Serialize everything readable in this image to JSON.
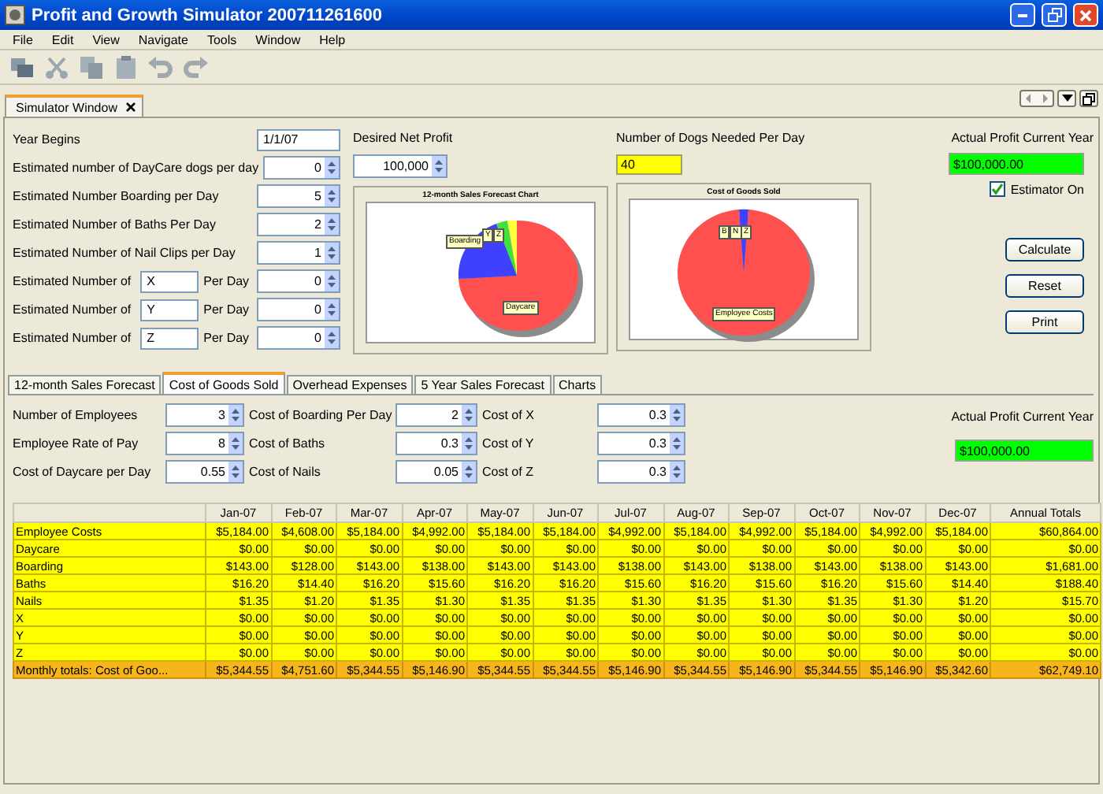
{
  "window": {
    "title": "Profit and Growth Simulator 200711261600"
  },
  "menu": [
    "File",
    "Edit",
    "View",
    "Navigate",
    "Tools",
    "Window",
    "Help"
  ],
  "document_tab": {
    "label": "Simulator Window",
    "selected": true
  },
  "year_begins": {
    "label": "Year Begins",
    "value": "1/1/07"
  },
  "estimates": [
    {
      "kind": "plain",
      "label": "Estimated number of DayCare dogs per day",
      "value": "0"
    },
    {
      "kind": "plain",
      "label": "Estimated Number Boarding per Day",
      "value": "5"
    },
    {
      "kind": "plain",
      "label": "Estimated Number of Baths Per Day",
      "value": "2"
    },
    {
      "kind": "plain",
      "label": "Estimated Number of Nail Clips per Day",
      "value": "1"
    },
    {
      "kind": "named",
      "label": "Estimated Number of",
      "name": "X",
      "suffix": "Per Day",
      "value": "0"
    },
    {
      "kind": "named",
      "label": "Estimated Number of",
      "name": "Y",
      "suffix": "Per Day",
      "value": "0"
    },
    {
      "kind": "named",
      "label": "Estimated Number of",
      "name": "Z",
      "suffix": "Per Day",
      "value": "0"
    }
  ],
  "desired_net_profit": {
    "label": "Desired Net Profit",
    "value": "100,000"
  },
  "dogs_needed": {
    "label": "Number of Dogs Needed Per Day",
    "value": "40"
  },
  "actual_profit": {
    "label": "Actual Profit Current Year",
    "value": "$100,000.00"
  },
  "estimator": {
    "label": "Estimator On",
    "checked": true
  },
  "charts": [
    {
      "title": "12-month Sales Forecast Chart",
      "labels": [
        "Boarding",
        "Y",
        "Z",
        "Daycare"
      ]
    },
    {
      "title": "Cost of Goods Sold",
      "labels": [
        "B",
        "N",
        "Z",
        "Employee Costs"
      ]
    }
  ],
  "buttons": [
    "Calculate",
    "Reset",
    "Print"
  ],
  "tabs": [
    {
      "label": "12-month Sales Forecast",
      "selected": false
    },
    {
      "label": "Cost of Goods Sold",
      "selected": true
    },
    {
      "label": "Overhead Expenses",
      "selected": false
    },
    {
      "label": "5 Year Sales Forecast",
      "selected": false
    },
    {
      "label": "Charts",
      "selected": false
    }
  ],
  "cost_fields": [
    {
      "label": "Number of Employees",
      "value": "3"
    },
    {
      "label": "Cost of Boarding Per Day",
      "value": "2"
    },
    {
      "label": "Cost of X",
      "value": "0.3"
    },
    {
      "label": "Employee Rate of Pay",
      "value": "8"
    },
    {
      "label": "Cost of Baths",
      "value": "0.3"
    },
    {
      "label": "Cost of Y",
      "value": "0.3"
    },
    {
      "label": "Cost of Daycare per Day",
      "value": "0.55"
    },
    {
      "label": "Cost of Nails",
      "value": "0.05"
    },
    {
      "label": "Cost of Z",
      "value": "0.3"
    }
  ],
  "cost_actual_profit": {
    "label": "Actual Profit Current Year",
    "value": "$100,000.00"
  },
  "table": {
    "columns": [
      "Jan-07",
      "Feb-07",
      "Mar-07",
      "Apr-07",
      "May-07",
      "Jun-07",
      "Jul-07",
      "Aug-07",
      "Sep-07",
      "Oct-07",
      "Nov-07",
      "Dec-07",
      "Annual Totals"
    ],
    "rows": [
      {
        "kind": "item",
        "label": "Employee Costs",
        "cells": [
          "$5,184.00",
          "$4,608.00",
          "$5,184.00",
          "$4,992.00",
          "$5,184.00",
          "$5,184.00",
          "$4,992.00",
          "$5,184.00",
          "$4,992.00",
          "$5,184.00",
          "$4,992.00",
          "$5,184.00",
          "$60,864.00"
        ]
      },
      {
        "kind": "item",
        "label": "Daycare",
        "cells": [
          "$0.00",
          "$0.00",
          "$0.00",
          "$0.00",
          "$0.00",
          "$0.00",
          "$0.00",
          "$0.00",
          "$0.00",
          "$0.00",
          "$0.00",
          "$0.00",
          "$0.00"
        ]
      },
      {
        "kind": "item",
        "label": "Boarding",
        "cells": [
          "$143.00",
          "$128.00",
          "$143.00",
          "$138.00",
          "$143.00",
          "$143.00",
          "$138.00",
          "$143.00",
          "$138.00",
          "$143.00",
          "$138.00",
          "$143.00",
          "$1,681.00"
        ]
      },
      {
        "kind": "item",
        "label": "Baths",
        "cells": [
          "$16.20",
          "$14.40",
          "$16.20",
          "$15.60",
          "$16.20",
          "$16.20",
          "$15.60",
          "$16.20",
          "$15.60",
          "$16.20",
          "$15.60",
          "$14.40",
          "$188.40"
        ]
      },
      {
        "kind": "item",
        "label": "Nails",
        "cells": [
          "$1.35",
          "$1.20",
          "$1.35",
          "$1.30",
          "$1.35",
          "$1.35",
          "$1.30",
          "$1.35",
          "$1.30",
          "$1.35",
          "$1.30",
          "$1.20",
          "$15.70"
        ]
      },
      {
        "kind": "item",
        "label": "X",
        "cells": [
          "$0.00",
          "$0.00",
          "$0.00",
          "$0.00",
          "$0.00",
          "$0.00",
          "$0.00",
          "$0.00",
          "$0.00",
          "$0.00",
          "$0.00",
          "$0.00",
          "$0.00"
        ]
      },
      {
        "kind": "item",
        "label": "Y",
        "cells": [
          "$0.00",
          "$0.00",
          "$0.00",
          "$0.00",
          "$0.00",
          "$0.00",
          "$0.00",
          "$0.00",
          "$0.00",
          "$0.00",
          "$0.00",
          "$0.00",
          "$0.00"
        ]
      },
      {
        "kind": "item",
        "label": "Z",
        "cells": [
          "$0.00",
          "$0.00",
          "$0.00",
          "$0.00",
          "$0.00",
          "$0.00",
          "$0.00",
          "$0.00",
          "$0.00",
          "$0.00",
          "$0.00",
          "$0.00",
          "$0.00"
        ]
      },
      {
        "kind": "total",
        "label": "Monthly totals: Cost of Goo...",
        "cells": [
          "$5,344.55",
          "$4,751.60",
          "$5,344.55",
          "$5,146.90",
          "$5,344.55",
          "$5,344.55",
          "$5,146.90",
          "$5,344.55",
          "$5,146.90",
          "$5,344.55",
          "$5,146.90",
          "$5,342.60",
          "$62,749.10"
        ]
      }
    ]
  }
}
